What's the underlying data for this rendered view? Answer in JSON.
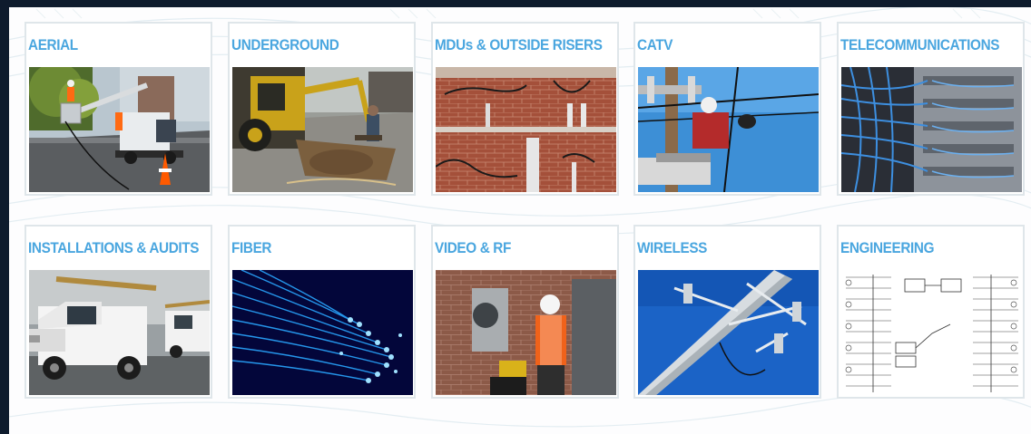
{
  "cards": [
    {
      "title": "AERIAL",
      "image": "aerial-bucket-truck-photo"
    },
    {
      "title": "UNDERGROUND",
      "image": "underground-excavator-photo"
    },
    {
      "title": "MDUs & OUTSIDE RISERS",
      "image": "brick-wall-risers-photo"
    },
    {
      "title": "CATV",
      "image": "catv-lineman-pole-photo"
    },
    {
      "title": "TELECOMMUNICATIONS",
      "image": "telecom-cabling-rack-photo"
    },
    {
      "title": "INSTALLATIONS & AUDITS",
      "image": "service-trucks-photo"
    },
    {
      "title": "FIBER",
      "image": "fiber-optic-strands-photo"
    },
    {
      "title": "VIDEO & RF",
      "image": "technician-wall-box-photo"
    },
    {
      "title": "WIRELESS",
      "image": "wireless-tower-photo"
    },
    {
      "title": "ENGINEERING",
      "image": "engineering-schematic-photo"
    }
  ],
  "colors": {
    "background": "#0e1b2d",
    "panel": "#fdfdfe",
    "title": "#4aa6df",
    "card_border": "#dfe6ea"
  }
}
